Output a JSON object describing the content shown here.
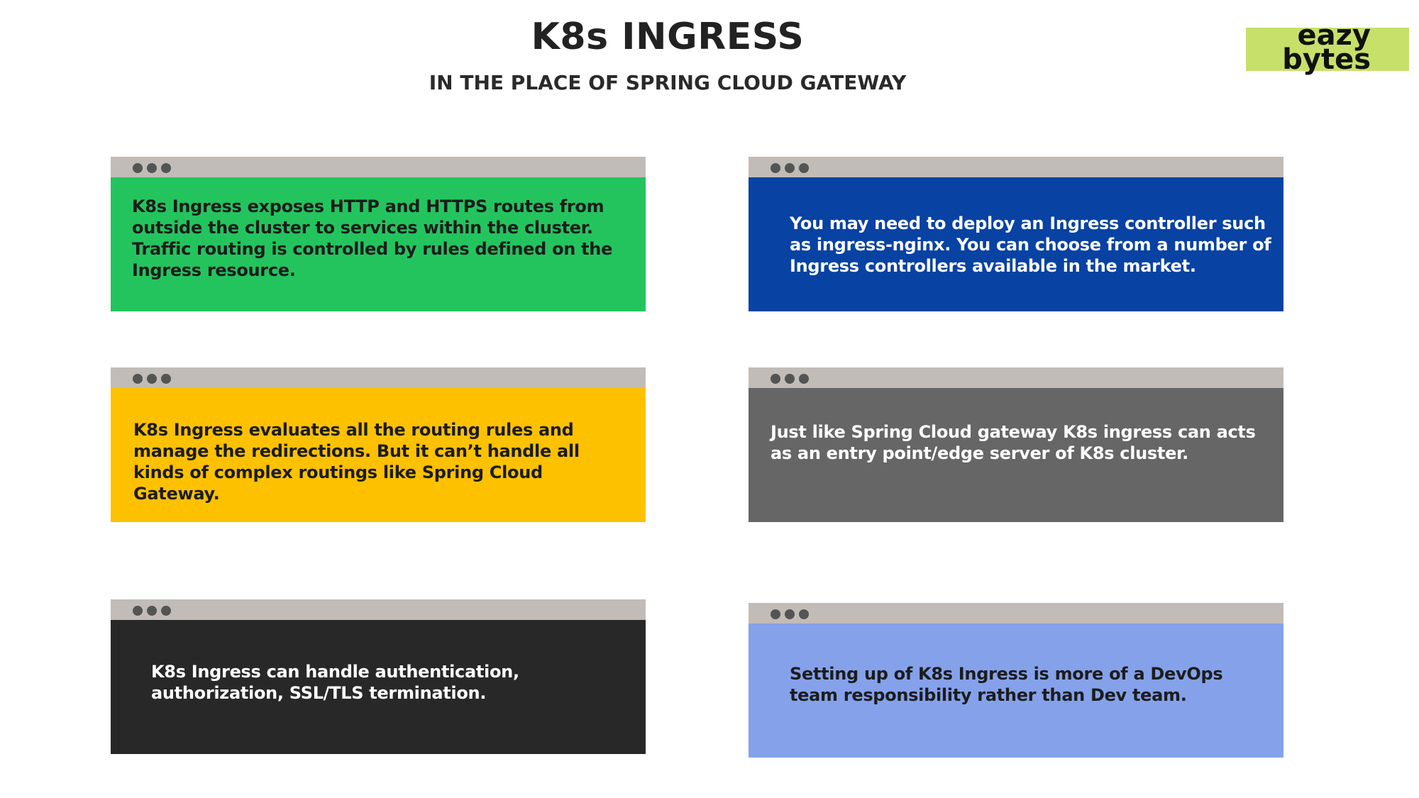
{
  "header": {
    "title": "K8s INGRESS",
    "subtitle": "IN THE PLACE OF SPRING CLOUD GATEWAY"
  },
  "logo": {
    "line1": "eazy",
    "line2": "bytes",
    "background": "#c7e06a"
  },
  "cards": [
    {
      "text": "K8s Ingress exposes HTTP and HTTPS routes from outside the cluster to services within the cluster. Traffic routing is controlled by rules defined on the Ingress resource.",
      "color": "#23c45e",
      "text_color": "#1c1c1c"
    },
    {
      "text": "You may need to deploy an Ingress controller such as ingress-nginx. You can choose from a number of Ingress controllers available in the market.",
      "color": "#0842a3",
      "text_color": "#ffffff"
    },
    {
      "text": "K8s Ingress evaluates all the routing rules and manage the redirections. But it can’t handle all kinds of complex routings like Spring Cloud Gateway.",
      "color": "#fdc100",
      "text_color": "#1c1c1c"
    },
    {
      "text": "Just like Spring Cloud gateway K8s ingress can acts as an entry point/edge server of K8s cluster.",
      "color": "#666666",
      "text_color": "#ffffff"
    },
    {
      "text": "K8s Ingress can handle authentication, authorization, SSL/TLS termination.",
      "color": "#282828",
      "text_color": "#ffffff"
    },
    {
      "text": "Setting up of K8s Ingress is more of a DevOps team responsibility rather than Dev team.",
      "color": "#84a1ea",
      "text_color": "#1c1c1c"
    }
  ],
  "window_bar_color": "#c1bcb7",
  "window_dot_color": "#545454"
}
